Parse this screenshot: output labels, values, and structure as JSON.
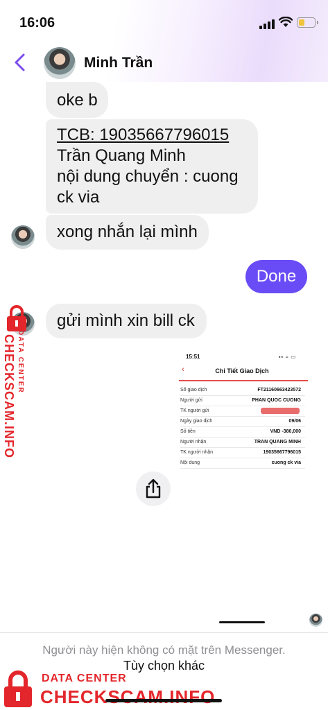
{
  "status_bar": {
    "time": "16:06"
  },
  "header": {
    "contact_name": "Minh Trần",
    "back_icon": "chevron-left-icon",
    "accent": "#7b4cf0"
  },
  "messages": [
    {
      "sender": "them",
      "text": "oke b"
    },
    {
      "sender": "them",
      "lines": [
        "TCB: 19035667796015",
        "Trần Quang Minh",
        "nội dung chuyển : cuong",
        "ck via"
      ]
    },
    {
      "sender": "them",
      "text": "xong nhắn lại mình"
    },
    {
      "sender": "me",
      "text": "Done"
    },
    {
      "sender": "them",
      "text": "gửi mình xin bill ck"
    }
  ],
  "bubble_colors": {
    "incoming": "#efeff0",
    "outgoing": "#6a4cf6"
  },
  "receipt": {
    "time": "15:51",
    "title": "Chi Tiết Giao Dịch",
    "rows": [
      {
        "label": "Số giao dịch",
        "value": "FT21160663423572"
      },
      {
        "label": "Người gửi",
        "value": "PHAN QUOC CUONG"
      },
      {
        "label": "TK người gửi",
        "value": ""
      },
      {
        "label": "Ngày giao dịch",
        "value": "09/06"
      },
      {
        "label": "Số tiền",
        "value": "VND -380,000"
      },
      {
        "label": "Người nhận",
        "value": "TRAN QUANG MINH"
      },
      {
        "label": "TK người nhận",
        "value": "19035667796015"
      },
      {
        "label": "Nội dung",
        "value": "cuong ck via"
      }
    ]
  },
  "footer": {
    "unavailable_text": "Người này hiện không có mặt trên Messenger.",
    "more_options": "Tùy chọn khác"
  },
  "watermark": {
    "line1": "DATA CENTER",
    "line2": "CHECKSCAM.INFO",
    "color": "#e3262b"
  }
}
